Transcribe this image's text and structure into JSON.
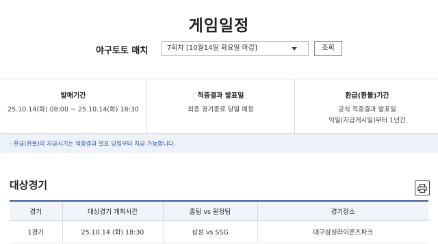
{
  "page": {
    "title": "게임일정"
  },
  "round_selector": {
    "label": "야구토토 매치",
    "selected": "7회차 [10월14일 화요일 마감]",
    "query_button": "조회"
  },
  "info": [
    {
      "head": "발매기간",
      "lines": [
        "25.10.14(화) 08:00 ~ 25.10.14(화) 18:30"
      ]
    },
    {
      "head": "적중결과 발표일",
      "lines": [
        "최종 경기종료 당일 예정"
      ]
    },
    {
      "head": "환급(환불)기간",
      "lines": [
        "공식 적중결과 발표일",
        "익일(지급개시일)부터 1년간"
      ]
    }
  ],
  "notice": "- 환급(환불)의 지급시기는 적중결과 발표 당일부터 지급 가능합니다.",
  "games_section": {
    "title": "대상경기",
    "print_icon": "printer-icon",
    "columns": [
      "경기",
      "대상경기 개최시간",
      "홈팀 vs 원정팀",
      "경기장소"
    ],
    "rows": [
      [
        "1경기",
        "25.10.14 (화) 18:30",
        "삼성 vs SSG",
        "대구삼성라이온즈파크"
      ]
    ]
  },
  "colors": {
    "accent": "#3d5a8a",
    "notice_bg": "#edf2f8",
    "notice_text": "#2b5cab"
  }
}
